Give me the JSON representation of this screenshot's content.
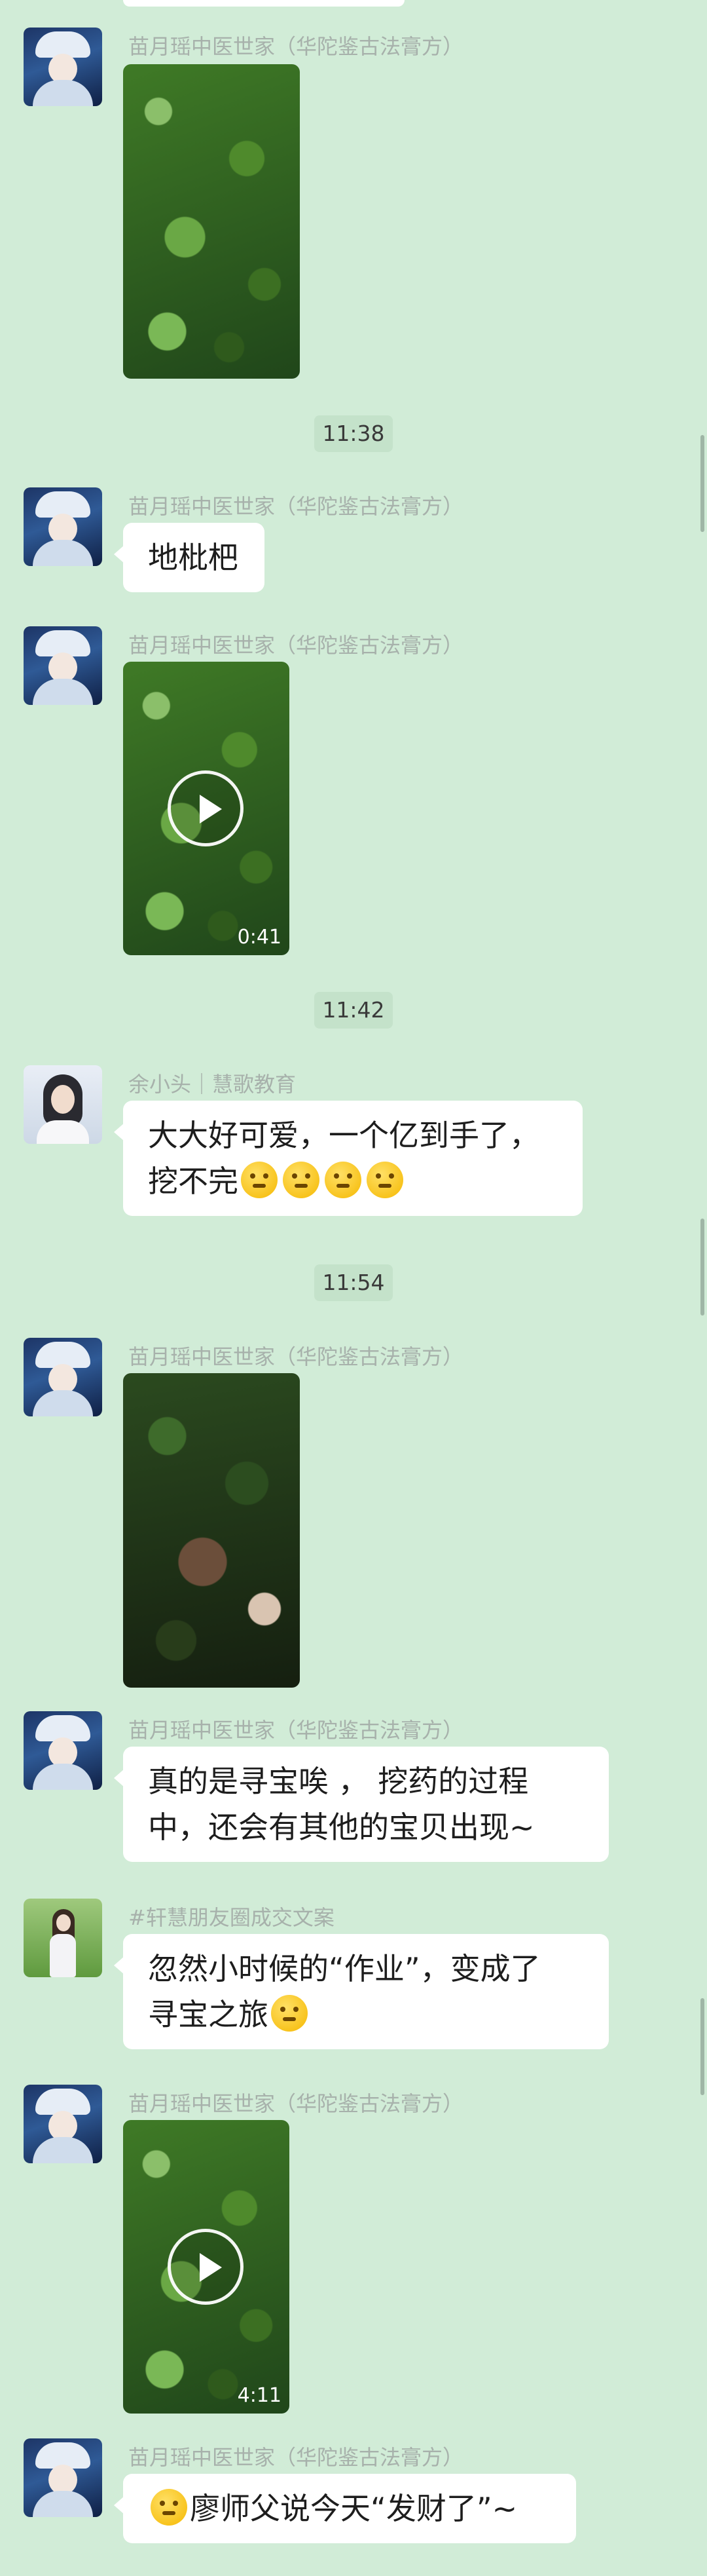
{
  "messages": [
    {
      "sender": "苗月瑶中医世家（华陀鉴古法膏方）",
      "type": "image"
    },
    {
      "time": "11:38"
    },
    {
      "sender": "苗月瑶中医世家（华陀鉴古法膏方）",
      "type": "text",
      "text": "地枇杷"
    },
    {
      "sender": "苗月瑶中医世家（华陀鉴古法膏方）",
      "type": "video",
      "duration": "0:41"
    },
    {
      "time": "11:42"
    },
    {
      "sender": "余小头｜慧歌教育",
      "type": "text",
      "line1": "大大好可爱，一个亿到手了，",
      "line2": "挖不完"
    },
    {
      "time": "11:54"
    },
    {
      "sender": "苗月瑶中医世家（华陀鉴古法膏方）",
      "type": "image"
    },
    {
      "sender": "苗月瑶中医世家（华陀鉴古法膏方）",
      "type": "text",
      "line1": "真的是寻宝唉 ， 挖药的过程",
      "line2": "中，还会有其他的宝贝出现~"
    },
    {
      "sender": "#轩慧朋友圈成交文案",
      "type": "text",
      "line1": "忽然小时候的“作业”，变成了",
      "line2": "寻宝之旅"
    },
    {
      "sender": "苗月瑶中医世家（华陀鉴古法膏方）",
      "type": "video",
      "duration": "4:11"
    },
    {
      "sender": "苗月瑶中医世家（华陀鉴古法膏方）",
      "type": "text",
      "text": "廖师父说今天“发财了”~"
    }
  ],
  "icons": {
    "emoji": "thinking-face-emoji",
    "play": "play-icon"
  },
  "colors": {
    "background": "#d1ecd7",
    "bubble": "#ffffff",
    "time_badge": "#c4e2ca"
  }
}
